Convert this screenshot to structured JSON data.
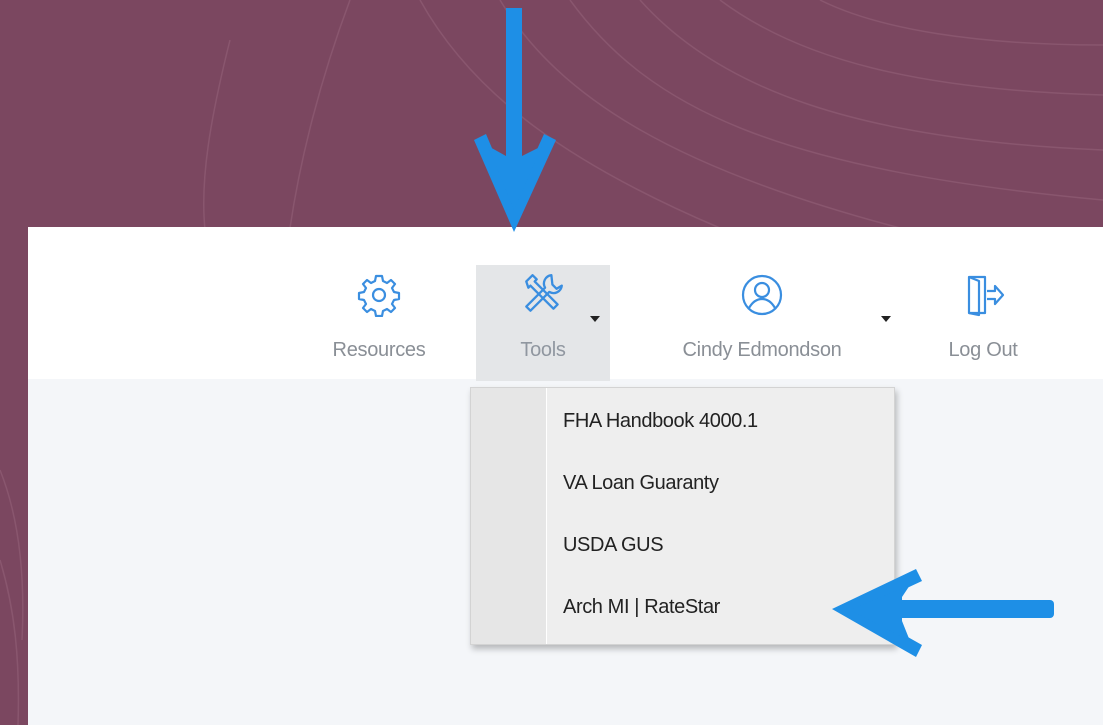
{
  "nav": {
    "resources": {
      "label": "Resources",
      "icon": "gear-icon"
    },
    "tools": {
      "label": "Tools",
      "icon": "tools-icon"
    },
    "user": {
      "label": "Cindy Edmondson",
      "icon": "user-circle-icon"
    },
    "logout": {
      "label": "Log Out",
      "icon": "logout-door-icon"
    }
  },
  "tools_menu": {
    "items": [
      {
        "label": "FHA Handbook 4000.1"
      },
      {
        "label": "VA Loan Guaranty"
      },
      {
        "label": "USDA GUS"
      },
      {
        "label": "Arch MI | RateStar"
      }
    ]
  },
  "annotations": {
    "arrow_color": "#1e8fe6",
    "down_arrow_target": "Tools",
    "left_arrow_target": "Arch MI | RateStar"
  },
  "colors": {
    "background": "#7b4760",
    "icon_blue": "#3a8ee0",
    "menu_text": "#222222",
    "nav_text": "#8a8f96"
  }
}
